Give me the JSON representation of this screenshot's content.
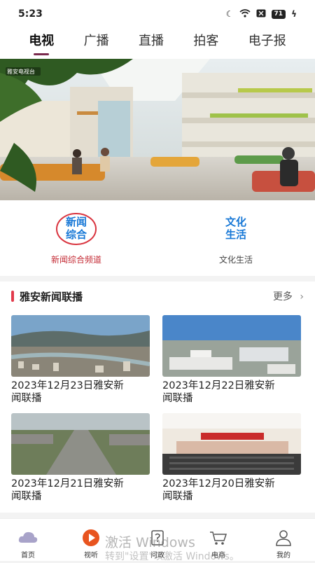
{
  "status": {
    "time": "5:23",
    "battery": "71"
  },
  "tabs": [
    {
      "label": "电视"
    },
    {
      "label": "广播"
    },
    {
      "label": "直播"
    },
    {
      "label": "拍客"
    },
    {
      "label": "电子报"
    }
  ],
  "hero": {
    "badge": "雅安电视台"
  },
  "channels": [
    {
      "logo_line1": "新闻",
      "logo_line2": "综合",
      "name": "新闻综合频道",
      "color": "#d9343f"
    },
    {
      "logo_line1": "文化",
      "logo_line2": "生活",
      "name": "文化生活",
      "color": "#1677d6"
    }
  ],
  "section": {
    "title": "雅安新闻联播",
    "more": "更多",
    "items": [
      {
        "title_line1": "2023年12月23日雅安新",
        "title_line2": "闻联播"
      },
      {
        "title_line1": "2023年12月22日雅安新",
        "title_line2": "闻联播"
      },
      {
        "title_line1": "2023年12月21日雅安新",
        "title_line2": "闻联播"
      },
      {
        "title_line1": "2023年12月20日雅安新",
        "title_line2": "闻联播"
      }
    ]
  },
  "bottom_nav": [
    {
      "label": "首页",
      "icon": "cloud-icon"
    },
    {
      "label": "视听",
      "icon": "play-icon"
    },
    {
      "label": "问政",
      "icon": "question-icon"
    },
    {
      "label": "电商",
      "icon": "cart-icon"
    },
    {
      "label": "我的",
      "icon": "user-icon"
    }
  ],
  "watermark": {
    "line1": "激活 Windows",
    "line2": "转到\"设置\"以激活 Windows。"
  }
}
